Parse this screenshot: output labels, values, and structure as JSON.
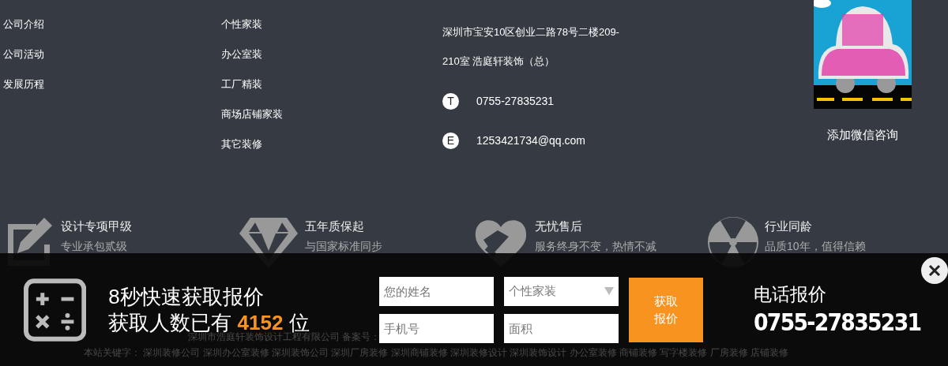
{
  "link_columns": [
    {
      "items": [
        "公司介绍",
        "公司活动",
        "发展历程"
      ]
    },
    {
      "items": [
        "个性家装",
        "办公室装",
        "工厂精装",
        "商场店铺家装",
        "其它装修"
      ]
    }
  ],
  "contact": {
    "address_lines": [
      "深圳市宝安10区创业二路78号二楼209-",
      "210室 浩庭轩装饰（总）"
    ],
    "phone": {
      "badge": "T",
      "text": "0755-27835231"
    },
    "email": {
      "badge": "E",
      "text": "1253421734@qq.com"
    }
  },
  "wechat": {
    "caption": "添加微信咨询"
  },
  "features": [
    {
      "kind": "pencil",
      "title": "设计专项甲级",
      "subtitle": "专业承包贰级"
    },
    {
      "kind": "diamond",
      "title": "五年质保起",
      "subtitle": "与国家标准同步"
    },
    {
      "kind": "heart",
      "title": "无忧售后",
      "subtitle": "服务终身不变，热情不减"
    },
    {
      "kind": "radiation",
      "title": "行业同龄",
      "subtitle": "品质10年，值得信赖"
    }
  ],
  "copyright": "深圳市浩庭轩装饰设计工程有限公司 备案号：",
  "keywords": {
    "label": "本站关键字：",
    "items": [
      "深圳装修公司",
      "深圳办公室装修",
      "深圳装饰公司",
      "深圳厂房装修",
      "深圳商铺装修",
      "深圳装修设计",
      "深圳装饰设计",
      "办公室装修",
      "商铺装修",
      "写字楼装修",
      "厂房装修",
      "店铺装修"
    ]
  },
  "quote_bar": {
    "title": "8秒快速获取报价",
    "count_prefix": "获取人数已有",
    "count": "4152",
    "count_suffix": "位",
    "fields": [
      {
        "kind": "input",
        "placeholder": "您的姓名"
      },
      {
        "kind": "select",
        "value": "个性家装"
      },
      {
        "kind": "input",
        "placeholder": "手机号"
      },
      {
        "kind": "input",
        "placeholder": "面积"
      }
    ],
    "button": "获取报价",
    "phone_title": "电话报价",
    "phone_number": "0755-27835231"
  }
}
